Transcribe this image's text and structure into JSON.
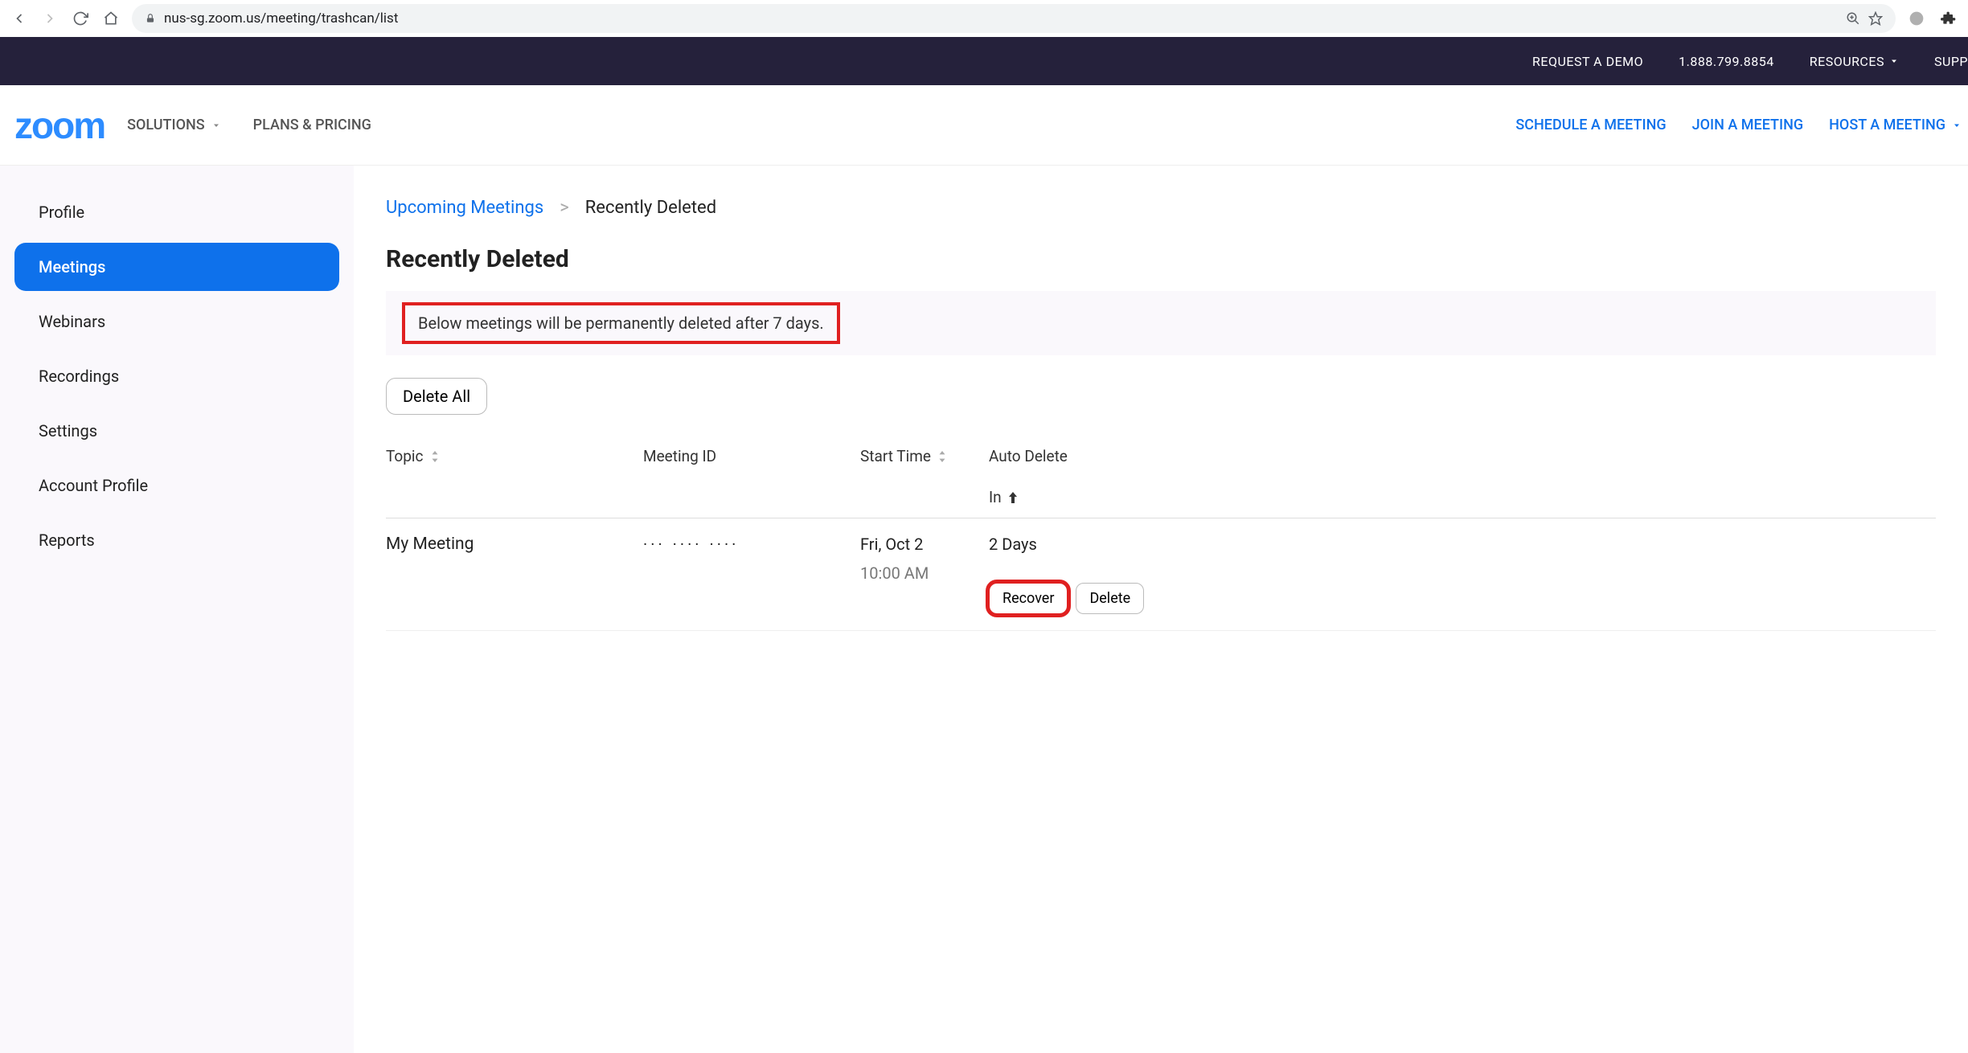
{
  "browser": {
    "url": "nus-sg.zoom.us/meeting/trashcan/list"
  },
  "topbar": {
    "request_demo": "REQUEST A DEMO",
    "phone": "1.888.799.8854",
    "resources": "RESOURCES",
    "support": "SUPP"
  },
  "mainnav": {
    "logo": "zoom",
    "solutions": "SOLUTIONS",
    "plans": "PLANS & PRICING",
    "schedule": "SCHEDULE A MEETING",
    "join": "JOIN A MEETING",
    "host": "HOST A MEETING"
  },
  "sidebar": {
    "items": [
      {
        "label": "Profile"
      },
      {
        "label": "Meetings"
      },
      {
        "label": "Webinars"
      },
      {
        "label": "Recordings"
      },
      {
        "label": "Settings"
      },
      {
        "label": "Account Profile"
      },
      {
        "label": "Reports"
      }
    ]
  },
  "breadcrumb": {
    "link": "Upcoming Meetings",
    "current": "Recently Deleted"
  },
  "page": {
    "title": "Recently Deleted",
    "notice": "Below meetings will be permanently deleted after 7 days.",
    "delete_all": "Delete All"
  },
  "columns": {
    "topic": "Topic",
    "meeting_id": "Meeting ID",
    "start_time": "Start Time",
    "auto_delete": "Auto Delete",
    "in": "In"
  },
  "rows": [
    {
      "topic": "My Meeting",
      "meeting_id": "··· ···· ····",
      "start_date": "Fri, Oct 2",
      "start_time": "10:00 AM",
      "auto_delete_in": "2 Days",
      "recover": "Recover",
      "delete": "Delete"
    }
  ]
}
